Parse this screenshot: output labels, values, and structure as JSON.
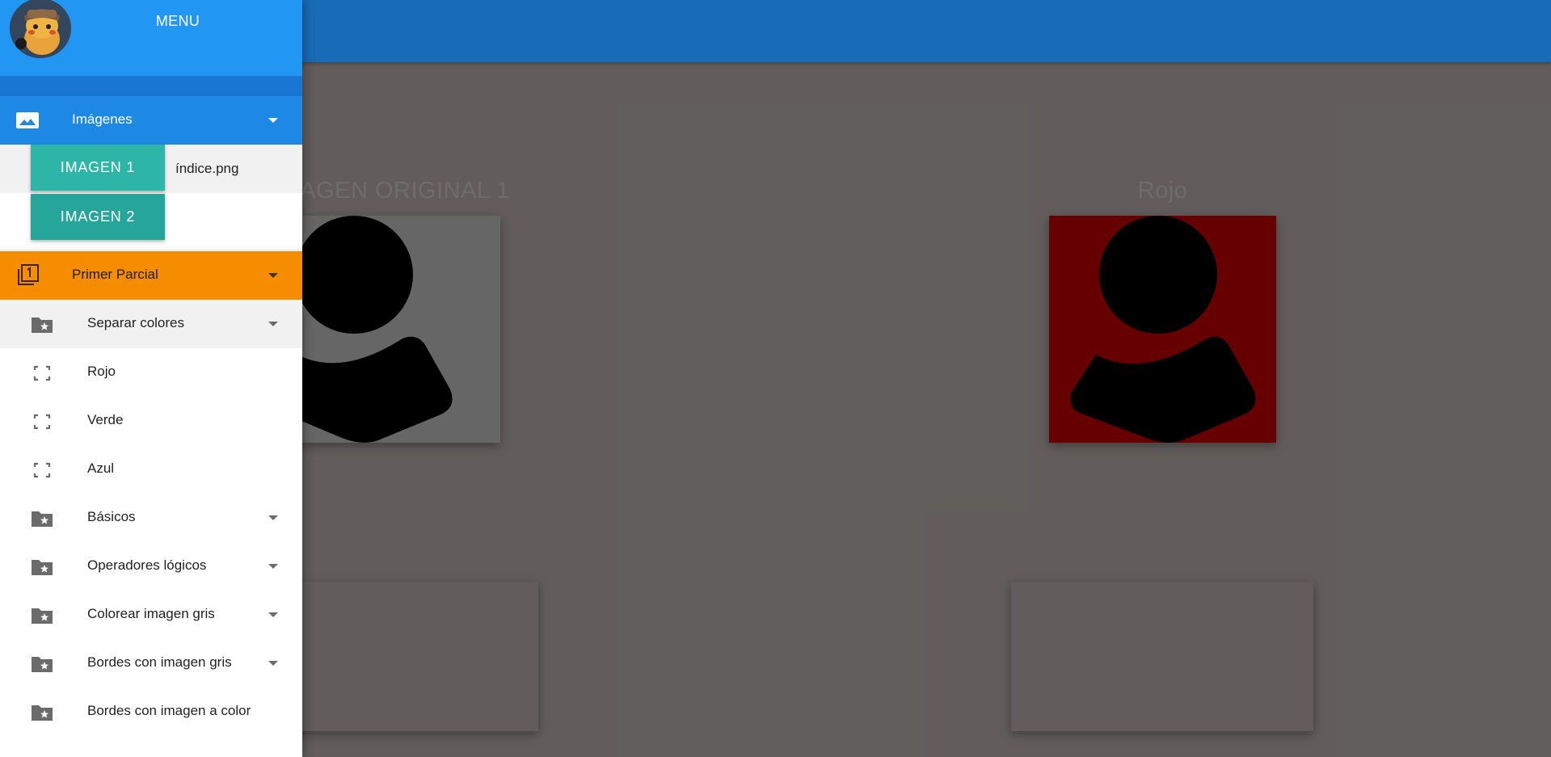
{
  "drawer": {
    "title": "MENU",
    "images_section": {
      "label": "Imágenes",
      "image1_button": "IMAGEN 1",
      "image1_file": "índice.png",
      "image2_button": "IMAGEN 2"
    },
    "parcial_section": {
      "label": "Primer Parcial",
      "submenu": "Separar colores",
      "items": [
        "Rojo",
        "Verde",
        "Azul"
      ],
      "groups": [
        "Básicos",
        "Operadores lógicos",
        "Colorear imagen gris",
        "Bordes con imagen gris",
        "Bordes con imagen a color"
      ]
    }
  },
  "main": {
    "original_title": "IMAGEN ORIGINAL 1",
    "result_title": "Rojo"
  },
  "colors": {
    "app_bar": "#1e88e5",
    "drawer_header": "#2196f3",
    "teal_button": "#26a69a",
    "parcial_accent": "#f68d00",
    "result_red": "#800000",
    "original_gray": "#808080"
  }
}
